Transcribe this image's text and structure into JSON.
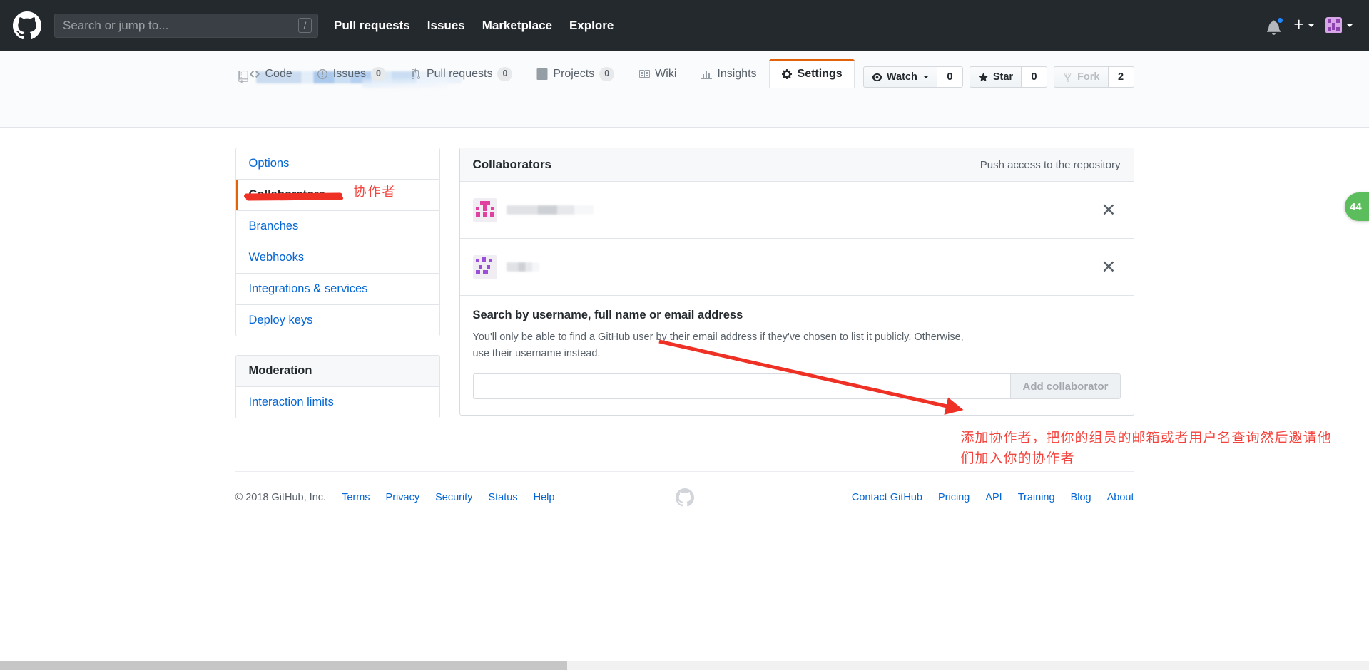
{
  "header": {
    "logo_icon": "github-mark-icon",
    "search_placeholder": "Search or jump to...",
    "search_value": "",
    "slash_hint": "/",
    "nav": [
      {
        "label": "Pull requests"
      },
      {
        "label": "Issues"
      },
      {
        "label": "Marketplace"
      },
      {
        "label": "Explore"
      }
    ],
    "notifications_icon": "bell-icon",
    "has_unread": true,
    "create_new_icon": "plus-icon",
    "avatar_icon": "user-avatar"
  },
  "repo": {
    "repo_icon": "repository-icon",
    "name_redacted": true,
    "actions": [
      {
        "id": "watch",
        "label": "Watch",
        "icon": "eye-icon",
        "count": "0",
        "has_caret": true,
        "disabled": false
      },
      {
        "id": "star",
        "label": "Star",
        "icon": "star-icon",
        "count": "0",
        "has_caret": false,
        "disabled": false
      },
      {
        "id": "fork",
        "label": "Fork",
        "icon": "fork-icon",
        "count": "2",
        "has_caret": false,
        "disabled": true
      }
    ],
    "tabs": [
      {
        "id": "code",
        "label": "Code",
        "icon": "code-icon",
        "count": null,
        "selected": false
      },
      {
        "id": "issues",
        "label": "Issues",
        "icon": "issue-opened-icon",
        "count": "0",
        "selected": false
      },
      {
        "id": "pull-requests",
        "label": "Pull requests",
        "icon": "git-pull-request-icon",
        "count": "0",
        "selected": false
      },
      {
        "id": "projects",
        "label": "Projects",
        "icon": "project-icon",
        "count": "0",
        "selected": false
      },
      {
        "id": "wiki",
        "label": "Wiki",
        "icon": "book-icon",
        "count": null,
        "selected": false
      },
      {
        "id": "insights",
        "label": "Insights",
        "icon": "graph-icon",
        "count": null,
        "selected": false
      },
      {
        "id": "settings",
        "label": "Settings",
        "icon": "gear-icon",
        "count": null,
        "selected": true
      }
    ]
  },
  "sidebar": {
    "items": [
      {
        "id": "options",
        "label": "Options",
        "selected": false
      },
      {
        "id": "collaborators",
        "label": "Collaborators",
        "selected": true
      },
      {
        "id": "branches",
        "label": "Branches",
        "selected": false
      },
      {
        "id": "webhooks",
        "label": "Webhooks",
        "selected": false
      },
      {
        "id": "integrations",
        "label": "Integrations & services",
        "selected": false
      },
      {
        "id": "deploy-keys",
        "label": "Deploy keys",
        "selected": false
      }
    ],
    "moderation_header": "Moderation",
    "moderation_items": [
      {
        "id": "interaction-limits",
        "label": "Interaction limits",
        "selected": false
      }
    ]
  },
  "annotations": {
    "sidebar_note": "协作者",
    "main_note": "添加协作者，把你的组员的邮箱或者用户名查询然后邀请他们加入你的协作者",
    "color": "#f4433c"
  },
  "main": {
    "panel_title": "Collaborators",
    "panel_subtitle": "Push access to the repository",
    "collaborators": [
      {
        "username_redacted": true,
        "avatar_color": "#e040a0",
        "remove_label": "✕"
      },
      {
        "username_redacted": true,
        "avatar_color": "#9b4fd8",
        "remove_label": "✕"
      }
    ],
    "search": {
      "title": "Search by username, full name or email address",
      "description": "You'll only be able to find a GitHub user by their email address if they've chosen to list it publicly. Otherwise, use their username instead.",
      "input_value": "",
      "input_placeholder": "",
      "button_label": "Add collaborator",
      "button_disabled": true
    }
  },
  "footer": {
    "copyright": "© 2018 GitHub, Inc.",
    "left_links": [
      {
        "label": "Terms"
      },
      {
        "label": "Privacy"
      },
      {
        "label": "Security"
      },
      {
        "label": "Status"
      },
      {
        "label": "Help"
      }
    ],
    "mark_icon": "github-mark-icon",
    "right_links": [
      {
        "label": "Contact GitHub"
      },
      {
        "label": "Pricing"
      },
      {
        "label": "API"
      },
      {
        "label": "Training"
      },
      {
        "label": "Blog"
      },
      {
        "label": "About"
      }
    ]
  },
  "edge_widget": {
    "label": "44",
    "color": "#5bbd5b"
  }
}
